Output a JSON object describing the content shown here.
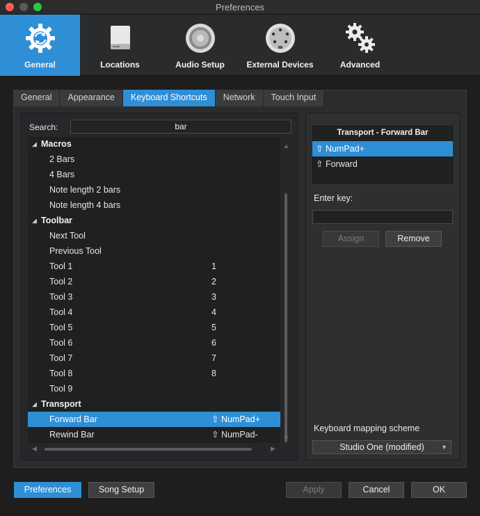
{
  "window": {
    "title": "Preferences"
  },
  "categories": [
    {
      "label": "General",
      "icon": "gear-sync-icon",
      "active": true
    },
    {
      "label": "Locations",
      "icon": "drive-icon",
      "active": false
    },
    {
      "label": "Audio Setup",
      "icon": "speaker-icon",
      "active": false
    },
    {
      "label": "External Devices",
      "icon": "midi-port-icon",
      "active": false
    },
    {
      "label": "Advanced",
      "icon": "gears-icon",
      "active": false
    }
  ],
  "subtabs": [
    {
      "label": "General",
      "active": false
    },
    {
      "label": "Appearance",
      "active": false
    },
    {
      "label": "Keyboard Shortcuts",
      "active": true
    },
    {
      "label": "Network",
      "active": false
    },
    {
      "label": "Touch Input",
      "active": false
    }
  ],
  "search": {
    "label": "Search:",
    "value": "bar"
  },
  "tree": [
    {
      "type": "group",
      "name": "Macros"
    },
    {
      "type": "item",
      "name": "2 Bars",
      "key": ""
    },
    {
      "type": "item",
      "name": "4 Bars",
      "key": ""
    },
    {
      "type": "item",
      "name": "Note length 2 bars",
      "key": ""
    },
    {
      "type": "item",
      "name": "Note length 4 bars",
      "key": ""
    },
    {
      "type": "group",
      "name": "Toolbar"
    },
    {
      "type": "item",
      "name": "Next Tool",
      "key": ""
    },
    {
      "type": "item",
      "name": "Previous Tool",
      "key": ""
    },
    {
      "type": "item",
      "name": "Tool 1",
      "key": "1"
    },
    {
      "type": "item",
      "name": "Tool 2",
      "key": "2"
    },
    {
      "type": "item",
      "name": "Tool 3",
      "key": "3"
    },
    {
      "type": "item",
      "name": "Tool 4",
      "key": "4"
    },
    {
      "type": "item",
      "name": "Tool 5",
      "key": "5"
    },
    {
      "type": "item",
      "name": "Tool 6",
      "key": "6"
    },
    {
      "type": "item",
      "name": "Tool 7",
      "key": "7"
    },
    {
      "type": "item",
      "name": "Tool 8",
      "key": "8"
    },
    {
      "type": "item",
      "name": "Tool 9",
      "key": ""
    },
    {
      "type": "group",
      "name": "Transport"
    },
    {
      "type": "item",
      "name": "Forward Bar",
      "key": "⇧ NumPad+",
      "selected": true
    },
    {
      "type": "item",
      "name": "Rewind Bar",
      "key": "⇧ NumPad-"
    }
  ],
  "command": {
    "title": "Transport - Forward Bar",
    "shortcuts": [
      {
        "label": "⇧ NumPad+",
        "selected": true
      },
      {
        "label": "⇧ Forward",
        "selected": false
      }
    ]
  },
  "enter_key": {
    "label": "Enter key:",
    "value": ""
  },
  "buttons": {
    "assign": "Assign",
    "remove": "Remove",
    "preferences": "Preferences",
    "song_setup": "Song Setup",
    "apply": "Apply",
    "cancel": "Cancel",
    "ok": "OK"
  },
  "mapping": {
    "label": "Keyboard mapping scheme",
    "selected": "Studio One (modified)"
  },
  "colors": {
    "accent": "#2f8fd6",
    "background": "#2b2c2e",
    "list": "#1f2022"
  }
}
